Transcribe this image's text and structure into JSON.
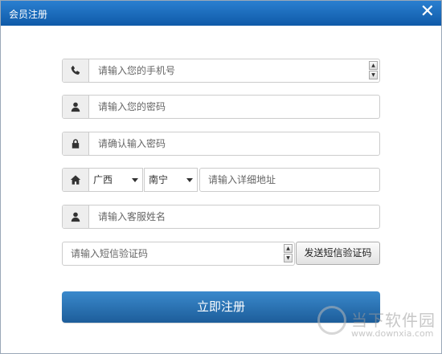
{
  "dialog": {
    "title": "会员注册",
    "close_symbol": "✕"
  },
  "form": {
    "phone": {
      "icon": "phone-icon",
      "placeholder": "请输入您的手机号"
    },
    "password": {
      "icon": "user-icon",
      "placeholder": "请输入您的密码"
    },
    "confirm_password": {
      "icon": "lock-icon",
      "placeholder": "请确认输入密码"
    },
    "address": {
      "icon": "home-icon",
      "province": "广西",
      "city": "南宁",
      "detail_placeholder": "请输入详细地址"
    },
    "service_name": {
      "icon": "user-icon",
      "placeholder": "请输入客服姓名"
    },
    "sms_code": {
      "placeholder": "请输入短信验证码",
      "send_button": "发送短信验证码"
    },
    "submit": "立即注册"
  },
  "watermark": {
    "name": "当下软件园",
    "url": "www.downxia.com"
  },
  "colors": {
    "titlebar": "#1565b8",
    "primary_button": "#2b72b5",
    "border": "#cccccc",
    "addon_bg": "#eeeeee"
  }
}
